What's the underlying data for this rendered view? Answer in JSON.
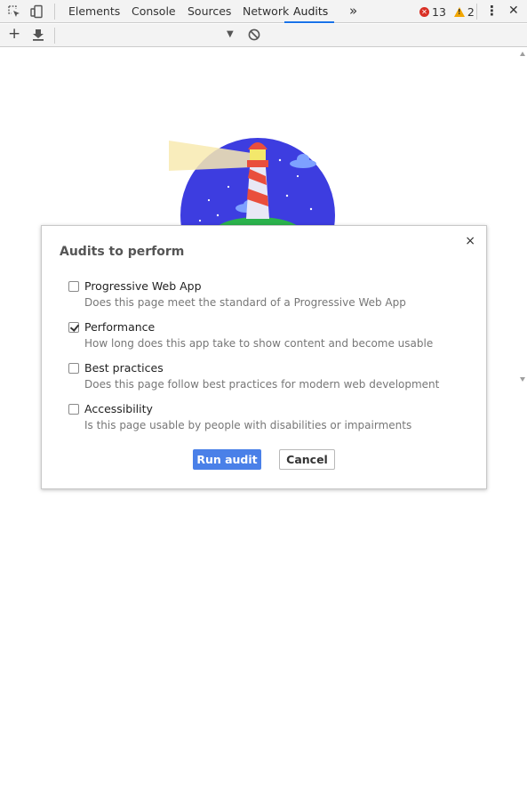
{
  "tabbar": {
    "tabs": [
      {
        "label": "Elements"
      },
      {
        "label": "Console"
      },
      {
        "label": "Sources"
      },
      {
        "label": "Network"
      },
      {
        "label": "Audits",
        "active": true
      }
    ],
    "more_glyph": "»",
    "error_count": "13",
    "warning_count": "2",
    "menu_glyph": "⋮",
    "close_glyph": "✕"
  },
  "toolbar2": {
    "add_glyph": "+",
    "dropdown_glyph": "▼"
  },
  "dialog": {
    "title": "Audits to perform",
    "close_glyph": "×",
    "options": [
      {
        "label": "Progressive Web App",
        "description": "Does this page meet the standard of a Progressive Web App",
        "checked": false
      },
      {
        "label": "Performance",
        "description": "How long does this app take to show content and become usable",
        "checked": true
      },
      {
        "label": "Best practices",
        "description": "Does this page follow best practices for modern web development",
        "checked": false
      },
      {
        "label": "Accessibility",
        "description": "Is this page usable by people with disabilities or impairments",
        "checked": false
      }
    ],
    "run_label": "Run audit",
    "cancel_label": "Cancel"
  },
  "colors": {
    "accent": "#1a73e8",
    "run_button": "#4a80e8",
    "lighthouse_sky": "#3d3de0",
    "error": "#d93025",
    "warning": "#f2a600"
  }
}
